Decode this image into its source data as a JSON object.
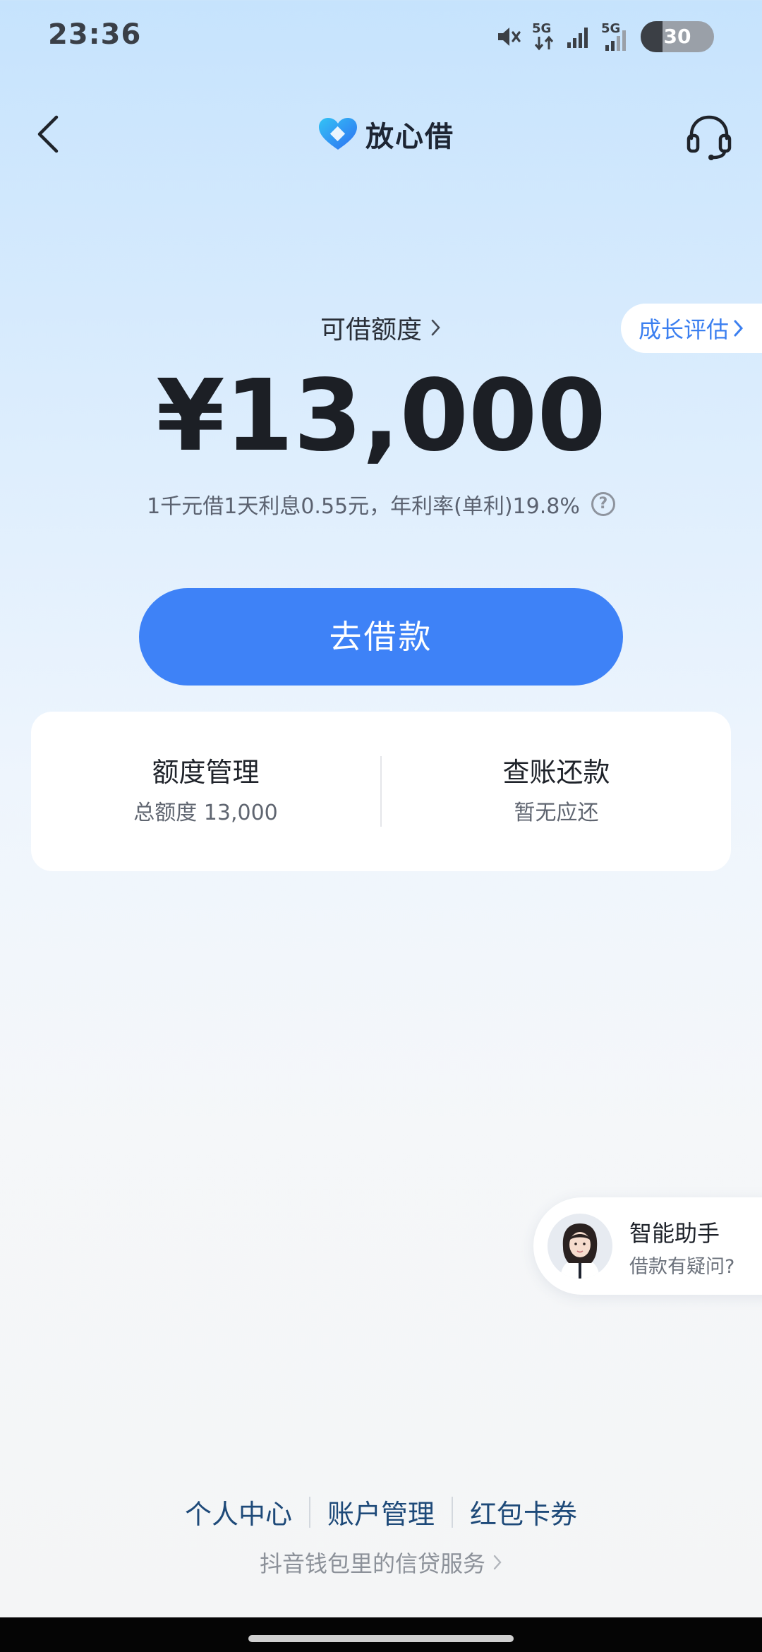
{
  "status_bar": {
    "time": "23:36",
    "network_1": "5G",
    "network_2": "5G",
    "battery": "30"
  },
  "nav": {
    "brand": "放心借"
  },
  "growth_link": "成长评估",
  "quota": {
    "label": "可借额度",
    "amount": "¥13,000",
    "rate_text": "1千元借1天利息0.55元，年利率(单利)19.8%"
  },
  "borrow_button": "去借款",
  "card": {
    "left_title": "额度管理",
    "left_sub": "总额度 13,000",
    "right_title": "查账还款",
    "right_sub": "暂无应还"
  },
  "assistant": {
    "title": "智能助手",
    "subtitle": "借款有疑问?"
  },
  "footer": {
    "links": [
      "个人中心",
      "账户管理",
      "红包卡券"
    ],
    "wallet_text": "抖音钱包里的信贷服务"
  },
  "colors": {
    "accent": "#3e82f7",
    "link_blue": "#3b7ff0",
    "footer_link": "#1e4a79"
  }
}
